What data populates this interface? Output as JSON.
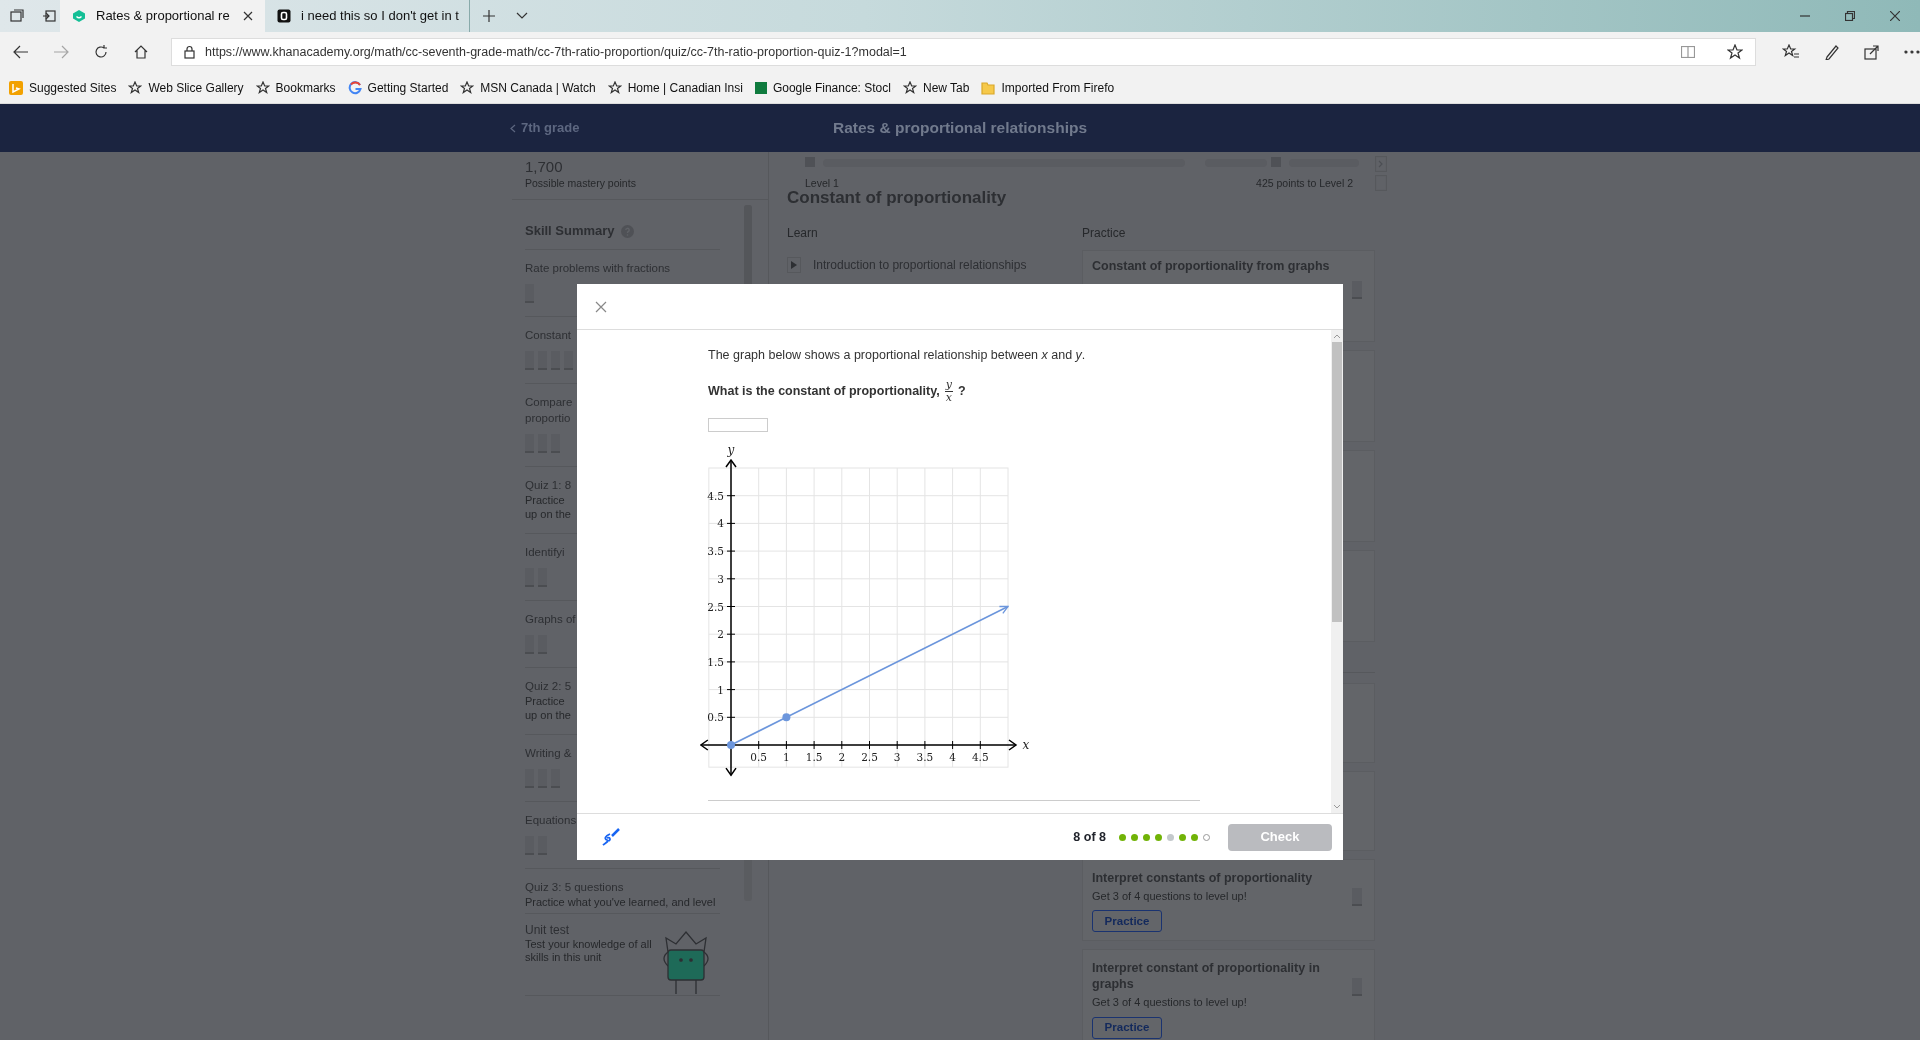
{
  "browser": {
    "tabs": [
      {
        "title": "Rates & proportional re",
        "selected": true
      },
      {
        "title": "i need this so I don't get in t",
        "selected": false
      }
    ],
    "address": "https://www.khanacademy.org/math/cc-seventh-grade-math/cc-7th-ratio-proportion/quiz/cc-7th-ratio-proportion-quiz-1?modal=1",
    "bookmarks": [
      {
        "label": "Suggested Sites",
        "kind": "bing"
      },
      {
        "label": "Web Slice Gallery",
        "kind": "star"
      },
      {
        "label": "Bookmarks",
        "kind": "star"
      },
      {
        "label": "Getting Started",
        "kind": "google"
      },
      {
        "label": "MSN Canada | Watch",
        "kind": "star"
      },
      {
        "label": "Home | Canadian Insi",
        "kind": "star"
      },
      {
        "label": "Google Finance: Stocl",
        "kind": "finance"
      },
      {
        "label": "New Tab",
        "kind": "star"
      },
      {
        "label": "Imported From Firefo",
        "kind": "folder"
      }
    ]
  },
  "header": {
    "back_link": "7th grade",
    "title": "Rates & proportional relationships"
  },
  "sidebar": {
    "points": "1,700",
    "points_label": "Possible mastery points",
    "section_title": "Skill Summary",
    "items": [
      {
        "kind": "skill",
        "lines": [
          "Rate problems with fractions"
        ],
        "boxes": [
          {
            "kind": "empty"
          }
        ]
      },
      {
        "kind": "skill",
        "lines": [
          "Constant"
        ],
        "boxes": [
          {
            "kind": "empty"
          },
          {
            "kind": "empty"
          },
          {
            "kind": "empty"
          },
          {
            "kind": "empty"
          }
        ]
      },
      {
        "kind": "skill",
        "lines": [
          "Compare",
          "proportio"
        ],
        "boxes": [
          {
            "kind": "empty"
          },
          {
            "kind": "empty"
          },
          {
            "kind": "empty"
          }
        ]
      },
      {
        "kind": "quiz",
        "lines": [
          "Quiz 1: 8"
        ],
        "description": [
          "Practice",
          "up on the"
        ]
      },
      {
        "kind": "skill",
        "lines": [
          "Identifyi"
        ],
        "boxes": [
          {
            "kind": "empty"
          },
          {
            "kind": "empty"
          }
        ]
      },
      {
        "kind": "skill",
        "lines": [
          "Graphs of"
        ],
        "boxes": [
          {
            "kind": "empty"
          },
          {
            "kind": "empty"
          }
        ]
      },
      {
        "kind": "quiz",
        "lines": [
          "Quiz 2: 5"
        ],
        "description": [
          "Practice",
          "up on the"
        ]
      },
      {
        "kind": "skill",
        "lines": [
          "Writing &"
        ],
        "boxes": [
          {
            "kind": "empty"
          },
          {
            "kind": "empty"
          },
          {
            "kind": "empty"
          }
        ]
      },
      {
        "kind": "skill",
        "lines": [
          "Equations"
        ],
        "boxes": [
          {
            "kind": "empty"
          },
          {
            "kind": "empty"
          }
        ]
      },
      {
        "kind": "quiz",
        "lines": [
          "Quiz 3: 5 questions"
        ],
        "description": [
          "Practice what you've learned, and level"
        ]
      }
    ],
    "unit_test": {
      "title": "Unit test",
      "description": [
        "Test your knowledge of all",
        "skills in this unit"
      ]
    }
  },
  "content": {
    "level_start": "Level 1",
    "level_end": "425 points to Level 2",
    "unit_title": "Constant of proportionality",
    "learn_heading": "Learn",
    "practice_heading": "Practice",
    "videos": [
      {
        "title": "Introduction to proportional relationships"
      }
    ],
    "top_card": {
      "title": "Constant of proportionality from graphs"
    },
    "lower_cards": [
      {
        "title": "Interpret constants of proportionality",
        "subtitle": "Get 3 of 4 questions to level up!",
        "button": "Practice"
      },
      {
        "title": "Interpret constant of proportionality in graphs",
        "subtitle": "Get 3 of 4 questions to level up!",
        "button": "Practice"
      }
    ]
  },
  "modal": {
    "intro": "The graph below shows a proportional relationship between *x* and *y*.",
    "question": "What is the constant of proportionality,",
    "fraction": {
      "numerator": "y",
      "denominator": "x"
    },
    "question_end": "?",
    "chart_data": {
      "type": "line",
      "grid": true,
      "xlabel": "x",
      "ylabel": "y",
      "x": [
        0,
        1,
        5
      ],
      "series": [
        {
          "color": "#6c96dc",
          "values": [
            0,
            0.5,
            2.5
          ]
        }
      ],
      "xlim": [
        -0.4,
        5
      ],
      "ylim": [
        -0.4,
        5
      ],
      "xticks": [
        0.5,
        1,
        1.5,
        2,
        2.5,
        3,
        3.5,
        4,
        4.5
      ],
      "yticks": [
        0.5,
        1,
        1.5,
        2,
        2.5,
        3,
        3.5,
        4,
        4.5
      ]
    },
    "progress_text": "8 of 8",
    "dots": [
      {
        "kind": "correct"
      },
      {
        "kind": "correct"
      },
      {
        "kind": "correct"
      },
      {
        "kind": "correct"
      },
      {
        "kind": "skipped"
      },
      {
        "kind": "correct"
      },
      {
        "kind": "correct"
      },
      {
        "kind": "current"
      }
    ],
    "check_button": {
      "label": "Check",
      "disabled": true
    }
  }
}
